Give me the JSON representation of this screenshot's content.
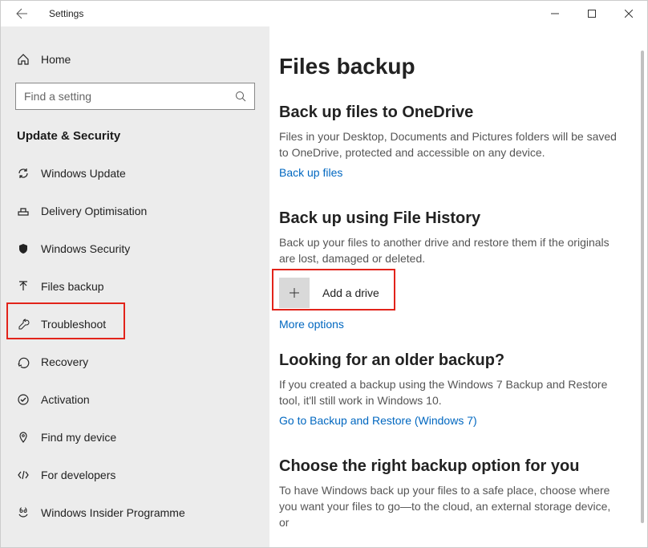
{
  "window": {
    "title": "Settings"
  },
  "sidebar": {
    "home": "Home",
    "search_placeholder": "Find a setting",
    "category": "Update & Security",
    "items": [
      {
        "label": "Windows Update"
      },
      {
        "label": "Delivery Optimisation"
      },
      {
        "label": "Windows Security"
      },
      {
        "label": "Files backup"
      },
      {
        "label": "Troubleshoot"
      },
      {
        "label": "Recovery"
      },
      {
        "label": "Activation"
      },
      {
        "label": "Find my device"
      },
      {
        "label": "For developers"
      },
      {
        "label": "Windows Insider Programme"
      }
    ]
  },
  "main": {
    "title": "Files backup",
    "onedrive": {
      "heading": "Back up files to OneDrive",
      "desc": "Files in your Desktop, Documents and Pictures folders will be saved to OneDrive, protected and accessible on any device.",
      "link": "Back up files"
    },
    "filehistory": {
      "heading": "Back up using File History",
      "desc": "Back up your files to another drive and restore them if the originals are lost, damaged or deleted.",
      "add_label": "Add a drive",
      "more_link": "More options"
    },
    "older": {
      "heading": "Looking for an older backup?",
      "desc": "If you created a backup using the Windows 7 Backup and Restore tool, it'll still work in Windows 10.",
      "link": "Go to Backup and Restore (Windows 7)"
    },
    "choose": {
      "heading": "Choose the right backup option for you",
      "desc": "To have Windows back up your files to a safe place, choose where you want your files to go—to the cloud, an external storage device, or"
    }
  }
}
